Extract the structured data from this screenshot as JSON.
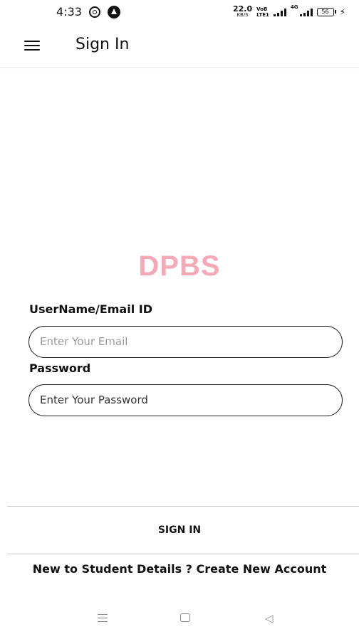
{
  "status_bar": {
    "time": "4:33",
    "net_speed_value": "22.0",
    "net_speed_unit": "KB/S",
    "volte_top": "VoB",
    "volte_bottom": "LTE1",
    "lte_tag": "4G",
    "battery_level": "56",
    "icons": [
      "whatsapp-icon",
      "navigation-app-icon",
      "signal-icon",
      "signal-4g-icon",
      "battery-icon",
      "charging-bolt-icon"
    ]
  },
  "app_bar": {
    "title": "Sign In",
    "menu_icon": "hamburger-menu-icon"
  },
  "logo": {
    "text": "DPBS",
    "color": "#f3a9b6"
  },
  "form": {
    "username_label": "UserName/Email ID",
    "email_placeholder": "Enter Your Email",
    "password_label": "Password",
    "password_placeholder": "Enter Your Password"
  },
  "actions": {
    "sign_in_label": "SIGN IN",
    "create_account_label": "New to Student Details ? Create New Account"
  },
  "system_nav": {
    "icons": [
      "recents-icon",
      "home-icon",
      "back-icon"
    ]
  }
}
